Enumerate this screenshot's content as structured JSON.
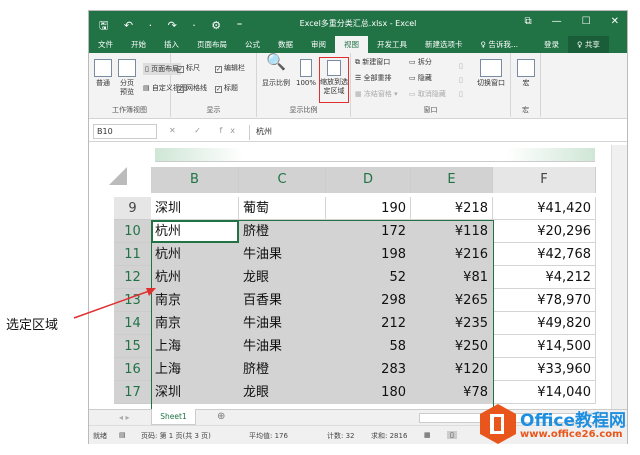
{
  "window": {
    "title": "Excel多重分类汇总.xlsx - Excel",
    "controls": [
      "⧉",
      "—",
      "☐",
      "✕"
    ]
  },
  "quick_access": "🖫 ↶ · ↷ · ⚙ ⁼",
  "tabs": [
    "文件",
    "开始",
    "插入",
    "页面布局",
    "公式",
    "数据",
    "审阅",
    "视图",
    "开发工具",
    "新建选项卡",
    "♀ 告诉我...",
    "登录",
    "♀ 共享"
  ],
  "active_tab": "视图",
  "ribbon": {
    "workbook_views": {
      "label": "工作簿视图",
      "normal": "普通",
      "page_break": "分页预览",
      "page_layout": "页面布局",
      "custom": "自定义视图"
    },
    "show": {
      "label": "显示",
      "ruler": "标尺",
      "formula_bar": "编辑栏",
      "gridlines": "网格线",
      "headings": "标题"
    },
    "zoom": {
      "label": "显示比例",
      "zoom": "显示比例",
      "hundred": "100%",
      "zoom_sel": "缩放到选定区域"
    },
    "window": {
      "label": "窗口",
      "new": "新建窗口",
      "arrange": "全部重排",
      "freeze": "冻结窗格 ▾",
      "split": "拆分",
      "hide": "隐藏",
      "unhide": "取消隐藏",
      "switch": "切换窗口"
    },
    "macro": {
      "label": "宏",
      "macro": "宏"
    }
  },
  "formula_bar": {
    "name_box": "B10",
    "fx": "✕ ✓ fx",
    "value": "杭州"
  },
  "columns": [
    "B",
    "C",
    "D",
    "E",
    "F"
  ],
  "rows": [
    {
      "n": "9",
      "city": "深圳",
      "fruit": "葡萄",
      "qty": "190",
      "price": "¥218",
      "total": "¥41,420"
    },
    {
      "n": "10",
      "city": "杭州",
      "fruit": "脐橙",
      "qty": "172",
      "price": "¥118",
      "total": "¥20,296"
    },
    {
      "n": "11",
      "city": "杭州",
      "fruit": "牛油果",
      "qty": "198",
      "price": "¥216",
      "total": "¥42,768"
    },
    {
      "n": "12",
      "city": "杭州",
      "fruit": "龙眼",
      "qty": "52",
      "price": "¥81",
      "total": "¥4,212"
    },
    {
      "n": "13",
      "city": "南京",
      "fruit": "百香果",
      "qty": "298",
      "price": "¥265",
      "total": "¥78,970"
    },
    {
      "n": "14",
      "city": "南京",
      "fruit": "牛油果",
      "qty": "212",
      "price": "¥235",
      "total": "¥49,820"
    },
    {
      "n": "15",
      "city": "上海",
      "fruit": "牛油果",
      "qty": "58",
      "price": "¥250",
      "total": "¥14,500"
    },
    {
      "n": "16",
      "city": "上海",
      "fruit": "脐橙",
      "qty": "283",
      "price": "¥120",
      "total": "¥33,960"
    },
    {
      "n": "17",
      "city": "深圳",
      "fruit": "龙眼",
      "qty": "180",
      "price": "¥78",
      "total": "¥14,040"
    }
  ],
  "sheet_tab": "Sheet1",
  "status": {
    "ready": "就绪",
    "page": "页码: 第 1 页(共 3 页)",
    "avg": "平均值: 176",
    "count": "计数: 32",
    "sum": "求和: 2816"
  },
  "annotation": "选定区域",
  "watermark": {
    "name": "Office教程网",
    "url": "www.office26.com"
  },
  "colors": {
    "excel_green": "#217346",
    "highlight": "#e03030",
    "selection": "#d3d3d3"
  }
}
